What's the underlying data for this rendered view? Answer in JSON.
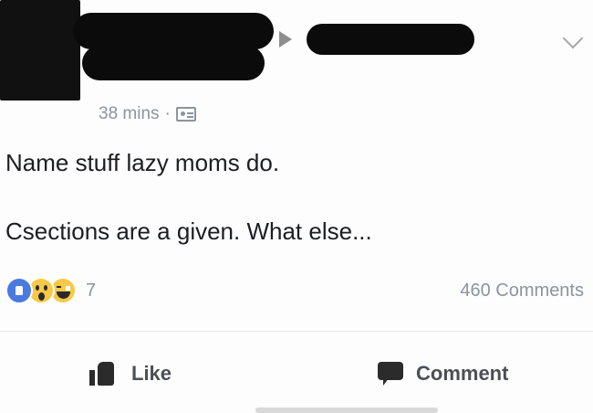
{
  "post": {
    "timestamp": "38 mins",
    "separator": "·",
    "audience_icon": "audience-icon",
    "lines": [
      "Name stuff lazy moms do.",
      "Csections are a given. What else..."
    ]
  },
  "reactions": {
    "types": [
      "like",
      "wow",
      "haha"
    ],
    "count": "7"
  },
  "comments_count": "460 Comments",
  "actions": {
    "like_label": "Like",
    "comment_label": "Comment"
  }
}
